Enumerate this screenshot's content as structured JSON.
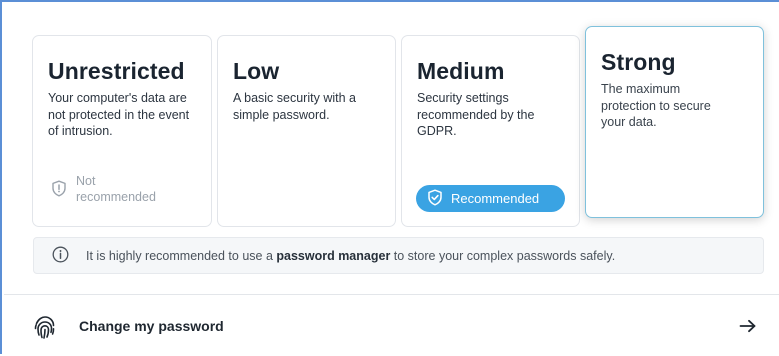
{
  "levels": [
    {
      "title": "Unrestricted",
      "description": "Your computer's data are not protected in the event of intrusion.",
      "note": "Not recommended"
    },
    {
      "title": "Low",
      "description": "A basic security with a simple password."
    },
    {
      "title": "Medium",
      "description": "Security settings recommended by the GDPR.",
      "badge": "Recommended"
    },
    {
      "title": "Strong",
      "description": "The maximum protection to secure your data.",
      "selected": true
    }
  ],
  "info": {
    "prefix": "It is highly recommended to use a ",
    "emphasis": "password manager",
    "suffix": " to store your complex passwords safely.",
    "icon": "info-icon"
  },
  "action": {
    "label": "Change my password",
    "icon": "fingerprint-icon",
    "arrow_icon": "arrow-right-icon"
  },
  "colors": {
    "frame_border": "#5b8fd6",
    "badge_bg": "#3aa3e3",
    "selected_border": "#7fc1dc"
  }
}
